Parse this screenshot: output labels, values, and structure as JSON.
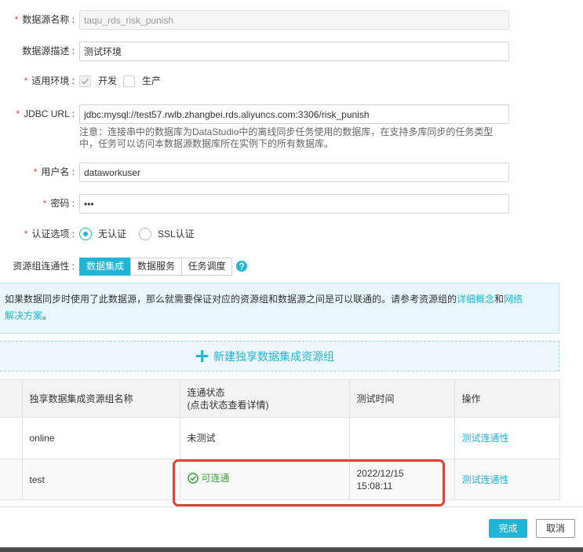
{
  "required_mark": "*",
  "form": {
    "name": {
      "label": "数据源名称 :",
      "required": true,
      "value": "taqu_rds_risk_punish",
      "disabled": true
    },
    "description": {
      "label": "数据源描述 :",
      "required": false,
      "value": "测试环境"
    },
    "environment": {
      "label": "适用环境 :",
      "required": true,
      "options": [
        {
          "label": "开发",
          "checked": true,
          "disabled": true
        },
        {
          "label": "生产",
          "checked": false
        }
      ]
    },
    "jdbc_url": {
      "label": "JDBC URL :",
      "required": true,
      "value": "jdbc:mysql://test57.rwlb.zhangbei.rds.aliyuncs.com:3306/risk_punish",
      "note_line1": "注意：连接串中的数据库为DataStudio中的离线同步任务使用的数据库，在支持多库同步的任务类型",
      "note_line2": "中，任务可以访问本数据源数据库所在实例下的所有数据库。"
    },
    "username": {
      "label": "用户名 :",
      "required": true,
      "value": "dataworkuser"
    },
    "password": {
      "label": "密码 :",
      "required": true,
      "value": "•••"
    },
    "auth": {
      "label": "认证选项 :",
      "required": true,
      "options": [
        {
          "label": "无认证",
          "selected": true
        },
        {
          "label": "SSL认证",
          "selected": false
        }
      ]
    },
    "connectivity": {
      "label": "资源组连通性 :",
      "tabs": [
        {
          "label": "数据集成",
          "active": true
        },
        {
          "label": "数据服务",
          "active": false
        },
        {
          "label": "任务调度",
          "active": false
        }
      ],
      "help_icon": "question-circle-icon"
    }
  },
  "info": {
    "text": "如果数据同步时使用了此数据源，那么就需要保证对应的资源组和数据源之间是可以联通的。请参考资源组的",
    "link_concept": "详细概念",
    "conjunction": "和",
    "link_network_line1": "网络",
    "link_network_line2": "解决方案",
    "end": "。"
  },
  "add_resource_group": {
    "icon": "plus-icon",
    "label": "新建独享数据集成资源组"
  },
  "table": {
    "headers": {
      "name": "独享数据集成资源组名称",
      "status": "连通状态",
      "status_hint": "(点击状态查看详情)",
      "time": "测试时间",
      "action": "操作"
    },
    "rows": [
      {
        "name": "online",
        "status": "未测试",
        "time_date": "",
        "time_clock": "",
        "action": "测试连通性"
      },
      {
        "name": "test",
        "status": "可连通",
        "status_icon": "check-circle-icon",
        "time_date": "2022/12/15",
        "time_clock": "15:08:11",
        "action": "测试连通性"
      }
    ]
  },
  "footer": {
    "confirm_label": "完成",
    "cancel_label": "取消"
  },
  "colors": {
    "accent": "#1fb5d8",
    "required": "#e5453b",
    "success": "#3ba335",
    "highlight": "#d6463b"
  }
}
